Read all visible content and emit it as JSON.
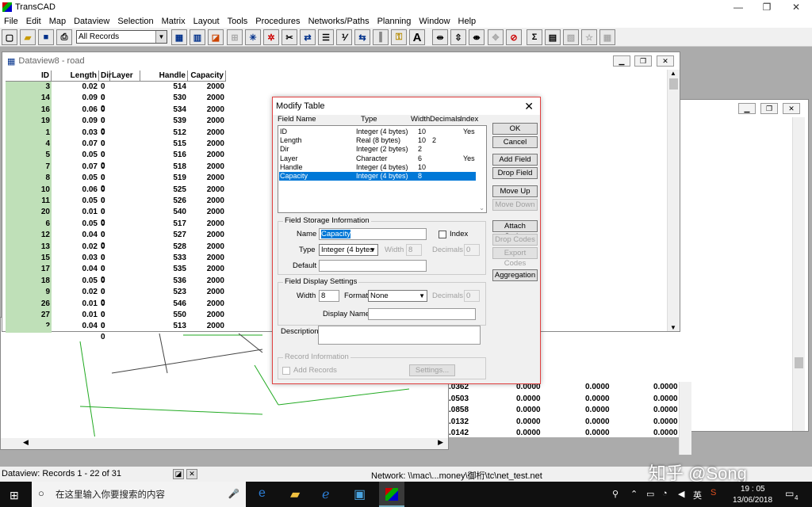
{
  "app": {
    "title": "TransCAD"
  },
  "window_controls": {
    "minimize": "—",
    "restore": "❐",
    "close": "✕"
  },
  "menu": [
    "File",
    "Edit",
    "Map",
    "Dataview",
    "Selection",
    "Matrix",
    "Layout",
    "Tools",
    "Procedures",
    "Networks/Paths",
    "Planning",
    "Window",
    "Help"
  ],
  "toolbar": {
    "selection_set": "All Records",
    "text_tool": "A"
  },
  "dataview": {
    "title": "Dataview8 - road",
    "columns": [
      "ID",
      "Length",
      "Dir",
      "Layer",
      "Handle",
      "Capacity"
    ],
    "rows": [
      [
        "3",
        "0.02",
        "0 0",
        "514",
        "2000"
      ],
      [
        "14",
        "0.09",
        "0 0",
        "530",
        "2000"
      ],
      [
        "16",
        "0.06",
        "0 0",
        "534",
        "2000"
      ],
      [
        "19",
        "0.09",
        "0 0",
        "539",
        "2000"
      ],
      [
        "1",
        "0.03",
        "0 0",
        "512",
        "2000"
      ],
      [
        "4",
        "0.07",
        "0 0",
        "515",
        "2000"
      ],
      [
        "5",
        "0.05",
        "0 0",
        "516",
        "2000"
      ],
      [
        "7",
        "0.07",
        "0 0",
        "518",
        "2000"
      ],
      [
        "8",
        "0.05",
        "0 0",
        "519",
        "2000"
      ],
      [
        "10",
        "0.06",
        "0 0",
        "525",
        "2000"
      ],
      [
        "11",
        "0.05",
        "0 0",
        "526",
        "2000"
      ],
      [
        "20",
        "0.01",
        "0 0",
        "540",
        "2000"
      ],
      [
        "6",
        "0.05",
        "0 0",
        "517",
        "2000"
      ],
      [
        "12",
        "0.04",
        "0 0",
        "527",
        "2000"
      ],
      [
        "13",
        "0.02",
        "0 0",
        "528",
        "2000"
      ],
      [
        "15",
        "0.03",
        "0 0",
        "533",
        "2000"
      ],
      [
        "17",
        "0.04",
        "0 0",
        "535",
        "2000"
      ],
      [
        "18",
        "0.05",
        "0 0",
        "536",
        "2000"
      ],
      [
        "9",
        "0.02",
        "0 0",
        "523",
        "2000"
      ],
      [
        "26",
        "0.01",
        "0 0",
        "546",
        "2000"
      ],
      [
        "27",
        "0.01",
        "0 0",
        "550",
        "2000"
      ],
      [
        "2",
        "0.04",
        "0 0",
        "513",
        "2000"
      ]
    ]
  },
  "back_table": {
    "rows": [
      [
        ".0362",
        "0.0000",
        "0.0000",
        "0.0000"
      ],
      [
        ".0503",
        "0.0000",
        "0.0000",
        "0.0000"
      ],
      [
        ".0858",
        "0.0000",
        "0.0000",
        "0.0000"
      ],
      [
        ".0132",
        "0.0000",
        "0.0000",
        "0.0000"
      ],
      [
        ".0142",
        "0.0000",
        "0.0000",
        "0.0000"
      ]
    ]
  },
  "dialog": {
    "title": "Modify Table",
    "headers": {
      "name": "Field Name",
      "type": "Type",
      "width": "Width",
      "decimals": "Decimals",
      "index": "Index"
    },
    "fields": [
      {
        "name": "ID",
        "type": "Integer (4 bytes)",
        "width": "10",
        "decimals": "",
        "index": "Yes"
      },
      {
        "name": "Length",
        "type": "Real (8 bytes)",
        "width": "10",
        "decimals": "2",
        "index": ""
      },
      {
        "name": "Dir",
        "type": "Integer (2 bytes)",
        "width": "2",
        "decimals": "",
        "index": ""
      },
      {
        "name": "Layer",
        "type": "Character",
        "width": "6",
        "decimals": "",
        "index": "Yes"
      },
      {
        "name": "Handle",
        "type": "Integer (4 bytes)",
        "width": "10",
        "decimals": "",
        "index": ""
      },
      {
        "name": "Capacity",
        "type": "Integer (4 bytes)",
        "width": "8",
        "decimals": "",
        "index": ""
      }
    ],
    "buttons": {
      "ok": "OK",
      "cancel": "Cancel",
      "add_field": "Add Field",
      "drop_field": "Drop Field",
      "move_up": "Move Up",
      "move_down": "Move Down",
      "attach_codes": "Attach Codes",
      "drop_codes": "Drop Codes",
      "export_codes": "Export Codes",
      "aggregation": "Aggregation",
      "settings": "Settings..."
    },
    "storage": {
      "group": "Field Storage Information",
      "name_label": "Name",
      "name_value": "Capacity",
      "index_label": "Index",
      "type_label": "Type",
      "type_value": "Integer (4 bytes",
      "width_label": "Width",
      "width_value": "8",
      "decimals_label": "Decimals",
      "decimals_value": "0",
      "default_label": "Default"
    },
    "display": {
      "group": "Field Display Settings",
      "width_label": "Width",
      "width_value": "8",
      "format_label": "Format",
      "format_value": "None",
      "decimals_label": "Decimals",
      "decimals_value": "0",
      "display_name_label": "Display Name"
    },
    "description_label": "Description",
    "record": {
      "group": "Record Information",
      "add_records": "Add Records"
    }
  },
  "status": {
    "records": "Dataview: Records 1 - 22 of 31",
    "network": "Network: \\\\mac\\...money\\御桁\\tc\\net_test.net"
  },
  "taskbar": {
    "search_placeholder": "在这里输入你要搜索的内容",
    "ime": "英",
    "time": "19 : 05",
    "date": "13/06/2018",
    "notify_count": "4"
  },
  "watermark": "知乎 @Song"
}
